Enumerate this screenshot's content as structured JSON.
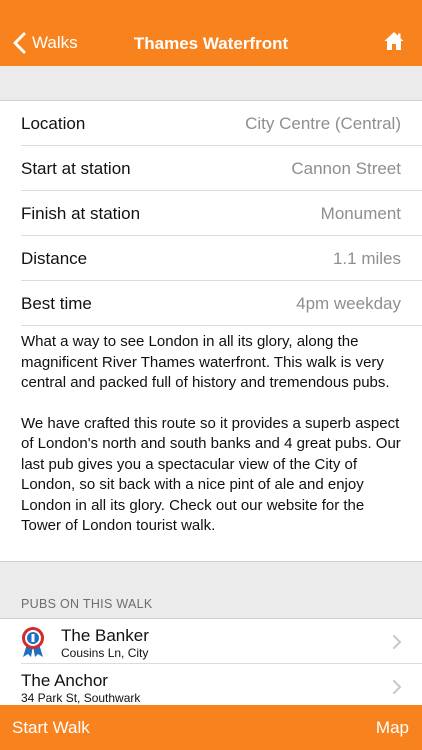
{
  "nav": {
    "back_label": "Walks",
    "title": "Thames Waterfront",
    "home_icon": "home-icon"
  },
  "details": [
    {
      "label": "Location",
      "value": "City Centre (Central)"
    },
    {
      "label": "Start at station",
      "value": "Cannon Street"
    },
    {
      "label": "Finish at station",
      "value": "Monument"
    },
    {
      "label": "Distance",
      "value": "1.1 miles"
    },
    {
      "label": "Best time",
      "value": "4pm weekday"
    }
  ],
  "description": {
    "p1": "What a way to see London in all its glory, along the magnificent River Thames waterfront. This walk is very central and packed full of history and tremendous pubs.",
    "p2": "We have crafted this route so it provides a superb aspect of London's north and south banks and 4 great pubs. Our last pub gives you a spectacular view of the City of London, so sit back with a nice pint of ale and enjoy London in all its glory. Check out our website for the Tower of London tourist walk."
  },
  "pubs_section": {
    "header": "PUBS ON THIS WALK",
    "items": [
      {
        "name": "The Banker",
        "address": "Cousins Ln, City",
        "badge": true
      },
      {
        "name": "The Anchor",
        "address": "34 Park St, Southwark",
        "badge": false
      }
    ]
  },
  "toolbar": {
    "start_label": "Start Walk",
    "map_label": "Map"
  },
  "colors": {
    "accent": "#f7821e",
    "secondary_text": "#8e8e93",
    "background": "#ebebeb"
  }
}
